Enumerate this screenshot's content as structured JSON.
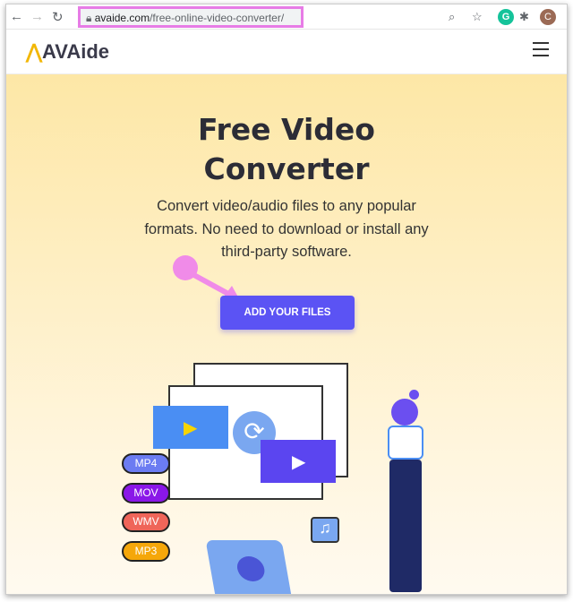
{
  "browser": {
    "url_domain": "avaide.com",
    "url_path": "/free-online-video-converter/",
    "profile_initial": "C",
    "extension_initial": "G"
  },
  "site": {
    "logo": "AVAide",
    "logo_accent": "#f2b705"
  },
  "hero": {
    "title_line1": "Free Video",
    "title_line2": "Converter",
    "subtitle": "Convert video/audio files to any popular formats. No need to download or install any third-party software.",
    "cta": "ADD YOUR FILES",
    "cta_color": "#5b53f4"
  },
  "formats": [
    {
      "label": "MP4",
      "color": "#6b7cf2"
    },
    {
      "label": "MOV",
      "color": "#8a17e8"
    },
    {
      "label": "WMV",
      "color": "#ef6559"
    },
    {
      "label": "MP3",
      "color": "#f5a70a"
    }
  ],
  "annotation": {
    "arrow_color": "#f08be8"
  }
}
